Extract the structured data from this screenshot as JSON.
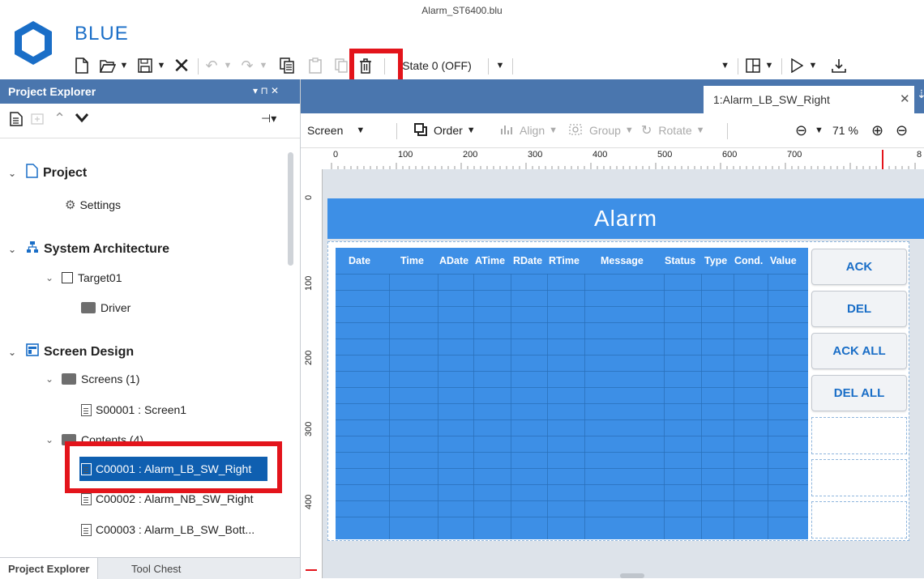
{
  "window": {
    "file_title": "Alarm_ST6400.blu",
    "app_name": "BLUE"
  },
  "toolbar": {
    "state_label": "State 0 (OFF)",
    "icons": [
      "new-file-icon",
      "open-icon",
      "save-icon",
      "delete-x-icon",
      "undo-icon",
      "redo-icon",
      "copy-icon",
      "paste-icon",
      "duplicate-icon",
      "trash-icon",
      "layout-icon",
      "play-icon",
      "download-icon"
    ]
  },
  "project_explorer": {
    "title": "Project Explorer",
    "pin": "▾ ⊓ ✕",
    "tree": {
      "project": "Project",
      "settings": "Settings",
      "system_architecture": "System Architecture",
      "target": "Target01",
      "driver": "Driver",
      "screen_design": "Screen Design",
      "screens": "Screens (1)",
      "screen1": "S00001 : Screen1",
      "contents": "Contents (4)",
      "c1": "C00001 : Alarm_LB_SW_Right",
      "c2": "C00002 : Alarm_NB_SW_Right",
      "c3": "C00003 : Alarm_LB_SW_Bott..."
    },
    "bottom_tabs": [
      "Project Explorer",
      "Tool Chest"
    ]
  },
  "editor": {
    "tab_label": "1:Alarm_LB_SW_Right",
    "toolbar": {
      "screen": "Screen",
      "order": "Order",
      "align": "Align",
      "group": "Group",
      "rotate": "Rotate",
      "zoom": "71 %"
    },
    "ruler_h": [
      "0",
      "100",
      "200",
      "300",
      "400",
      "500",
      "600",
      "700",
      "8"
    ],
    "ruler_v": [
      "0",
      "100",
      "200",
      "300",
      "400"
    ]
  },
  "alarm": {
    "title": "Alarm",
    "columns": [
      "Date",
      "Time",
      "ADate",
      "ATime",
      "RDate",
      "RTime",
      "Message",
      "Status",
      "Type",
      "Cond.",
      "Value"
    ],
    "buttons": [
      "ACK",
      "DEL",
      "ACK ALL",
      "DEL ALL"
    ]
  },
  "colors": {
    "accent": "#3d8fe6",
    "panel_header": "#4a76ae",
    "highlight_box": "#e3141b",
    "selection": "#0f5fb0"
  }
}
